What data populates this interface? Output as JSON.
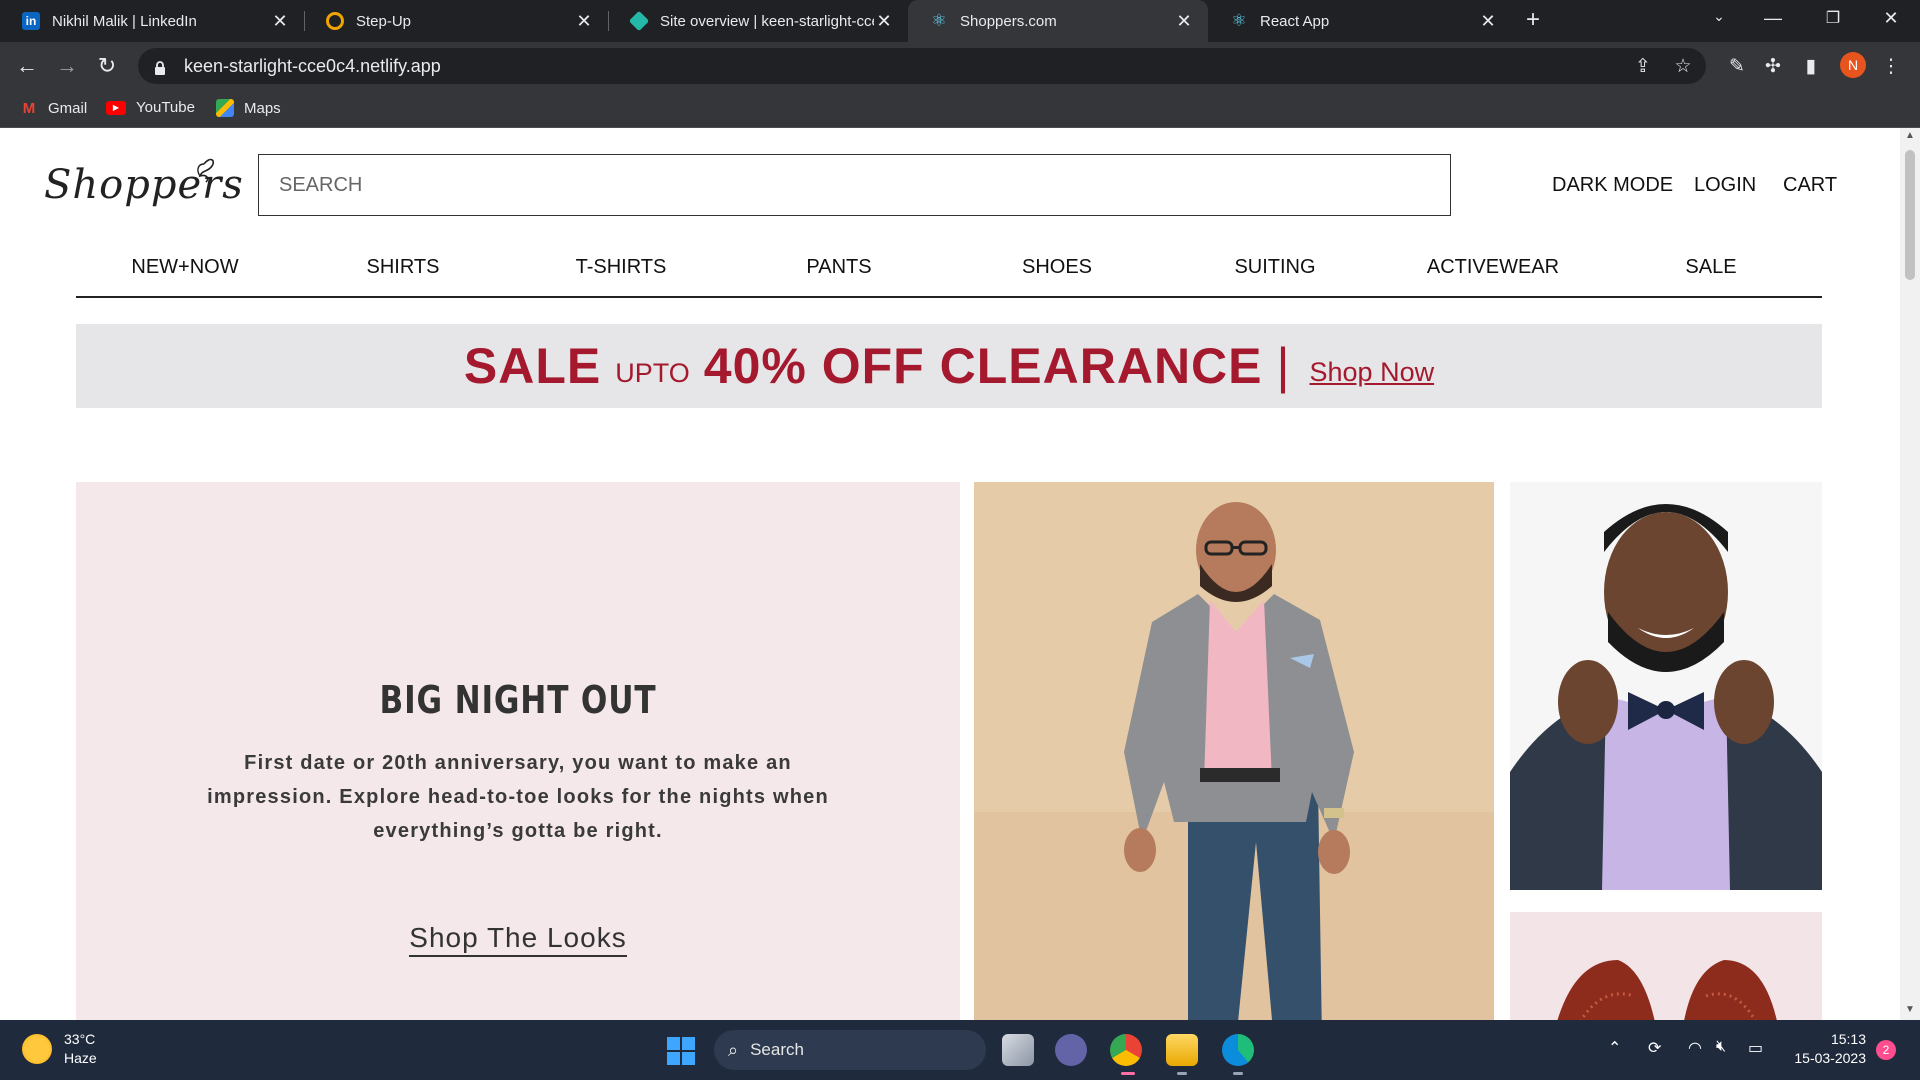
{
  "browser": {
    "tabs": [
      {
        "title": "Nikhil Malik | LinkedIn",
        "icon": "linkedin-icon"
      },
      {
        "title": "Step-Up",
        "icon": "stepup-icon"
      },
      {
        "title": "Site overview | keen-starlight-cce",
        "icon": "netlify-icon"
      },
      {
        "title": "Shoppers.com",
        "icon": "react-icon"
      },
      {
        "title": "React App",
        "icon": "react-icon"
      }
    ],
    "close_glyph": "✕",
    "url": "keen-starlight-cce0c4.netlify.app",
    "bookmarks": [
      {
        "label": "Gmail",
        "icon": "gmail-icon"
      },
      {
        "label": "YouTube",
        "icon": "youtube-icon"
      },
      {
        "label": "Maps",
        "icon": "maps-icon"
      }
    ],
    "profile_initial": "N"
  },
  "site": {
    "logo_text": "Shoppers",
    "search_placeholder": "SEARCH",
    "top_links": [
      "DARK MODE",
      "LOGIN",
      "CART"
    ],
    "categories": [
      "NEW+NOW",
      "SHIRTS",
      "T-SHIRTS",
      "PANTS",
      "SHOES",
      "SUITING",
      "ACTIVEWEAR",
      "SALE"
    ],
    "banner": {
      "sale": "SALE",
      "upto": "UPTO",
      "offer": "40% OFF CLEARANCE",
      "divider": "|",
      "shop_now": "Shop Now",
      "text_color": "#a5192e",
      "background": "#e6e6e8"
    },
    "hero": {
      "title": "BIG NIGHT OUT",
      "body": "First date or 20th anniversary, you want to make an impression. Explore head-to-toe looks for the nights when everything’s gotta be right.",
      "link": "Shop The Looks",
      "background": "#f4e8ea"
    }
  },
  "taskbar": {
    "temperature": "33°C",
    "condition": "Haze",
    "search_label": "Search",
    "time": "15:13",
    "date": "15-03-2023",
    "notifications": "2"
  }
}
